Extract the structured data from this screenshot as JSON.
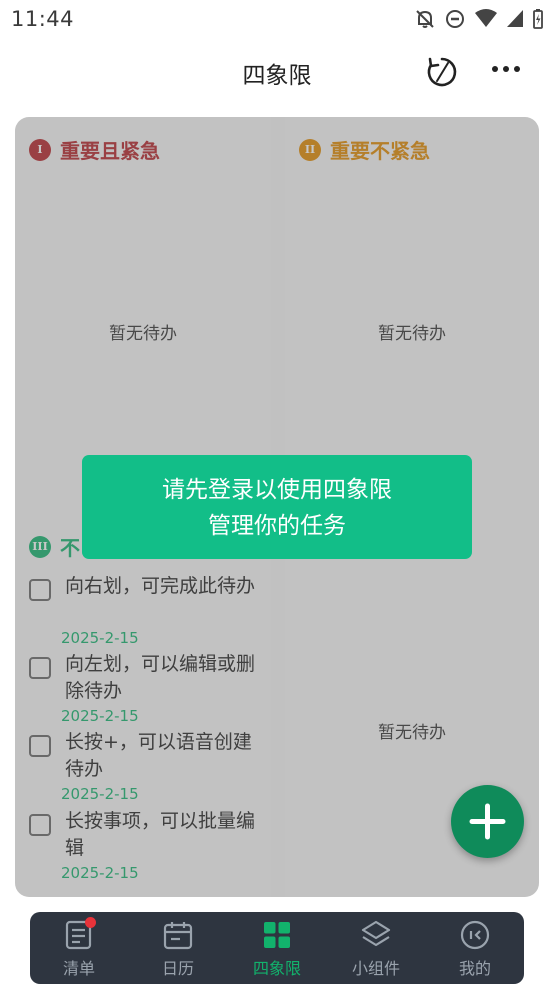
{
  "status_bar": {
    "time": "11:44",
    "icons": [
      "notifications-off-icon",
      "do-not-disturb-icon",
      "wifi-icon",
      "signal-icon",
      "battery-icon"
    ]
  },
  "header": {
    "title": "四象限",
    "icons": [
      "sync-icon",
      "more-icon"
    ]
  },
  "quadrants": {
    "q1": {
      "numeral": "I",
      "title": "重要且紧急",
      "color": "#b5252a",
      "empty_text": "暂无待办"
    },
    "q2": {
      "numeral": "II",
      "title": "重要不紧急",
      "color": "#e08a00",
      "empty_text": "暂无待办"
    },
    "q3": {
      "numeral": "III",
      "title": "不",
      "color": "#12b26c",
      "tasks": [
        {
          "text": "向右划，可完成此待办",
          "date": "2025-2-15"
        },
        {
          "text": "向左划，可以编辑或删除待办",
          "date": "2025-2-15"
        },
        {
          "text": "长按+，可以语音创建待办",
          "date": "2025-2-15"
        },
        {
          "text": "长按事项，可以批量编辑",
          "date": "2025-2-15"
        }
      ]
    },
    "q4": {
      "empty_text": "暂无待办"
    }
  },
  "toast": {
    "line1": "请先登录以使用四象限",
    "line2": "管理你的任务"
  },
  "fab": {
    "icon": "plus-icon",
    "color": "#0f8b5a"
  },
  "bottom_nav": {
    "items": [
      {
        "label": "清单",
        "icon": "list-icon",
        "has_badge": true
      },
      {
        "label": "日历",
        "icon": "calendar-icon"
      },
      {
        "label": "四象限",
        "icon": "quadrant-icon",
        "active": true
      },
      {
        "label": "小组件",
        "icon": "widget-layers-icon"
      },
      {
        "label": "我的",
        "icon": "profile-icon"
      }
    ],
    "active_color": "#12b26c"
  }
}
